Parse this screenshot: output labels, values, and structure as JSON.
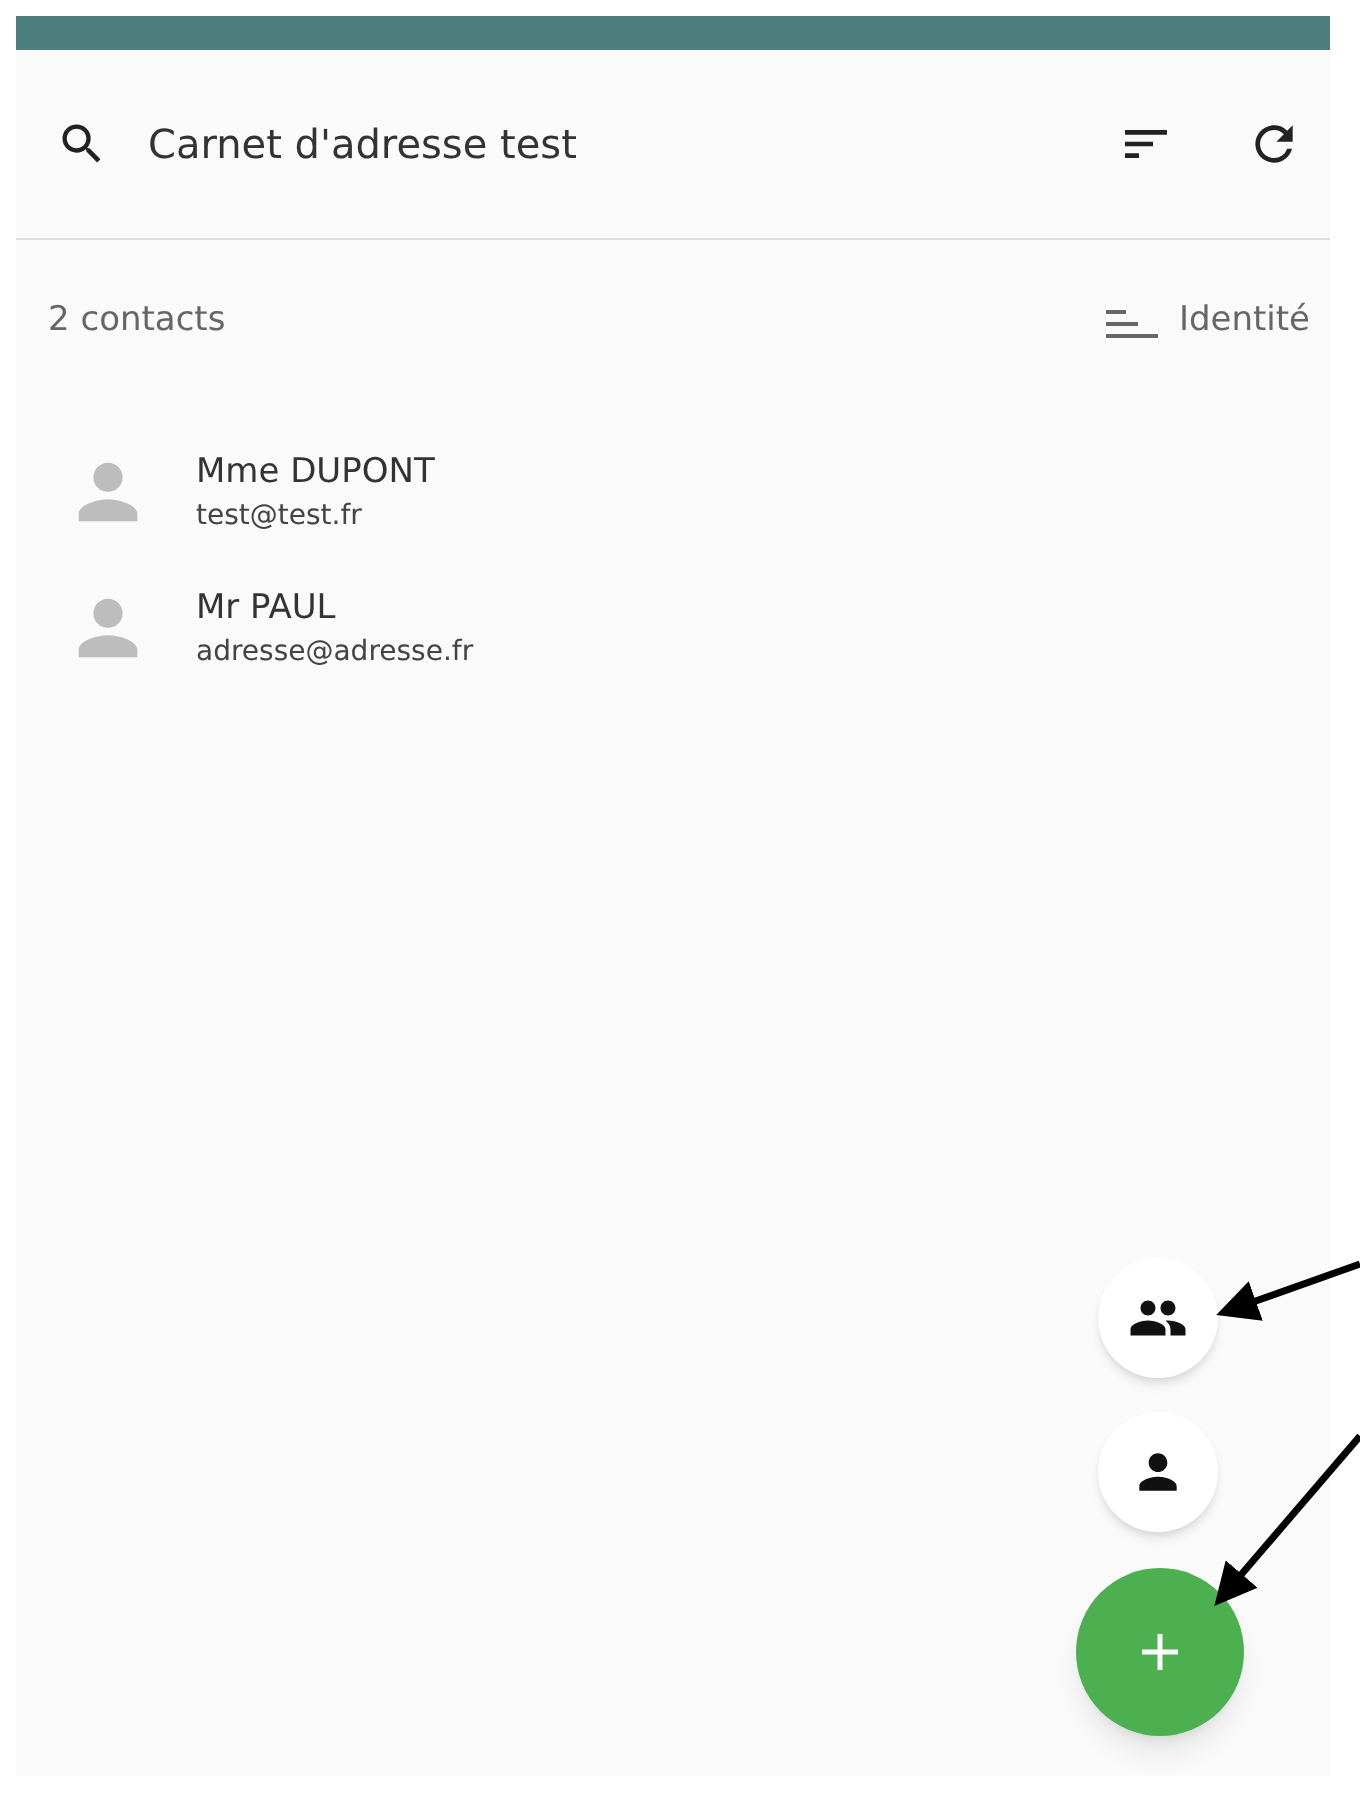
{
  "search": {
    "value": "Carnet d'adresse test"
  },
  "list_header": {
    "count": "2 contacts",
    "sort_label": "Identité"
  },
  "contacts": [
    {
      "name": "Mme DUPONT",
      "email": "test@test.fr"
    },
    {
      "name": "Mr PAUL",
      "email": "adresse@adresse.fr"
    }
  ]
}
